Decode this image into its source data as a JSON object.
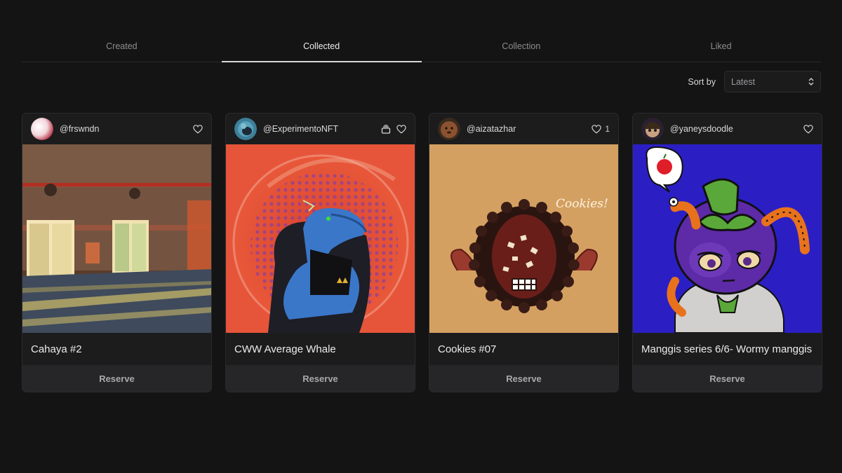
{
  "tabs": [
    {
      "label": "Created"
    },
    {
      "label": "Collected"
    },
    {
      "label": "Collection"
    },
    {
      "label": "Liked"
    }
  ],
  "active_tab": "Collected",
  "sort": {
    "label": "Sort by",
    "value": "Latest"
  },
  "cards": [
    {
      "handle": "@frswndn",
      "title": "Cahaya #2",
      "action": "Reserve",
      "likes": "",
      "icons": [
        "heart-icon"
      ]
    },
    {
      "handle": "@ExperimentoNFT",
      "title": "CWW Average Whale",
      "action": "Reserve",
      "likes": "",
      "icons": [
        "stack-icon",
        "heart-icon"
      ]
    },
    {
      "handle": "@aizatazhar",
      "title": "Cookies #07",
      "action": "Reserve",
      "likes": "1",
      "icons": [
        "heart-icon"
      ],
      "art_text": "Cookies!"
    },
    {
      "handle": "@yaneysdoodle",
      "title": "Manggis series 6/6- Wormy manggis",
      "action": "Reserve",
      "likes": "",
      "icons": [
        "heart-icon"
      ]
    }
  ],
  "colors": {
    "background": "#141415",
    "card": "#1c1c1d",
    "reserve_bar": "#262628",
    "active_tab_underline": "#d9d9d9"
  }
}
